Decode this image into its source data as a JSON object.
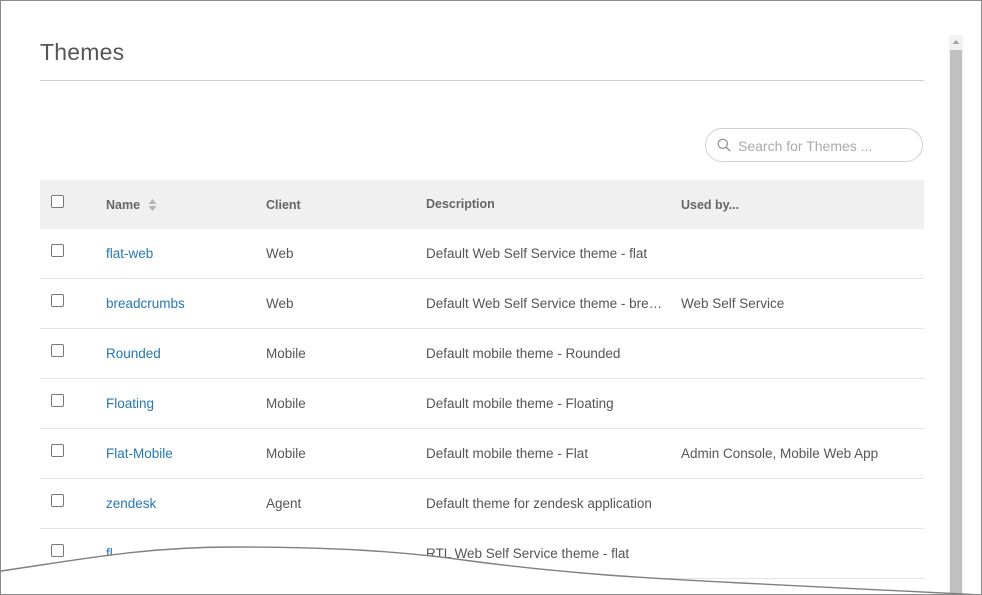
{
  "page": {
    "title": "Themes"
  },
  "search": {
    "placeholder": "Search for Themes ..."
  },
  "table": {
    "columns": [
      "Name",
      "Client",
      "Description",
      "Used by..."
    ],
    "rows": [
      {
        "name": "flat-web",
        "client": "Web",
        "description": "Default Web Self Service theme - flat",
        "used_by": ""
      },
      {
        "name": "breadcrumbs",
        "client": "Web",
        "description": "Default Web Self Service theme - breadcrumbs",
        "used_by": "Web Self Service"
      },
      {
        "name": "Rounded",
        "client": "Mobile",
        "description": "Default mobile theme - Rounded",
        "used_by": ""
      },
      {
        "name": "Floating",
        "client": "Mobile",
        "description": "Default mobile theme - Floating",
        "used_by": ""
      },
      {
        "name": "Flat-Mobile",
        "client": "Mobile",
        "description": "Default mobile theme - Flat",
        "used_by": "Admin Console, Mobile Web App"
      },
      {
        "name": "zendesk",
        "client": "Agent",
        "description": "Default theme for zendesk application",
        "used_by": ""
      },
      {
        "name": "fl...",
        "client": "",
        "description": "RTL Web Self Service theme - flat",
        "used_by": ""
      }
    ]
  },
  "colors": {
    "link": "#2677b5",
    "header_bg": "#f0f0f0",
    "text": "#555555"
  }
}
